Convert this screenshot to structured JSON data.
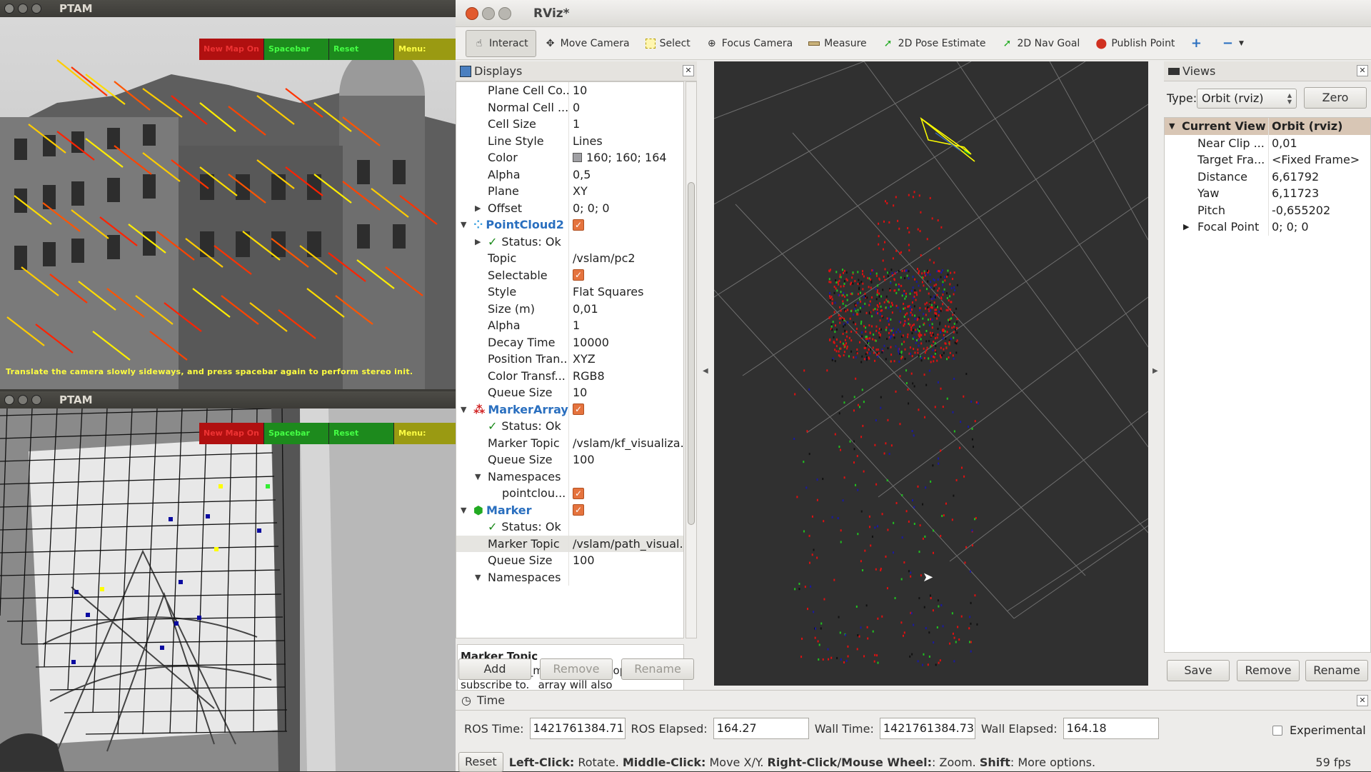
{
  "ptam_top": {
    "title": "PTAM",
    "menu": [
      "New Map On",
      "Spacebar",
      "Reset",
      "Menu:"
    ],
    "caption": "Translate the camera slowly sideways, and press spacebar again to perform stereo init."
  },
  "ptam_bottom": {
    "title": "PTAM",
    "menu": [
      "New Map On",
      "Spacebar",
      "Reset",
      "Menu:"
    ]
  },
  "rviz": {
    "title": "RViz*",
    "toolbar": {
      "interact": "Interact",
      "move_camera": "Move Camera",
      "select": "Select",
      "focus_camera": "Focus Camera",
      "measure": "Measure",
      "pose_estimate": "2D Pose Estimate",
      "nav_goal": "2D Nav Goal",
      "publish_point": "Publish Point"
    },
    "displays": {
      "title": "Displays",
      "rows": [
        {
          "k": "Plane Cell Co...",
          "v": "10"
        },
        {
          "k": "Normal Cell ...",
          "v": "0"
        },
        {
          "k": "Cell Size",
          "v": "1"
        },
        {
          "k": "Line Style",
          "v": "Lines"
        },
        {
          "k": "Color",
          "v": "160; 160; 164"
        },
        {
          "k": "Alpha",
          "v": "0,5"
        },
        {
          "k": "Plane",
          "v": "XY"
        },
        {
          "k": "Offset",
          "v": "0; 0; 0"
        },
        {
          "k": "PointCloud2",
          "v": ""
        },
        {
          "k": "Status: Ok",
          "v": ""
        },
        {
          "k": "Topic",
          "v": "/vslam/pc2"
        },
        {
          "k": "Selectable",
          "v": ""
        },
        {
          "k": "Style",
          "v": "Flat Squares"
        },
        {
          "k": "Size (m)",
          "v": "0,01"
        },
        {
          "k": "Alpha",
          "v": "1"
        },
        {
          "k": "Decay Time",
          "v": "10000"
        },
        {
          "k": "Position Tran...",
          "v": "XYZ"
        },
        {
          "k": "Color Transf...",
          "v": "RGB8"
        },
        {
          "k": "Queue Size",
          "v": "10"
        },
        {
          "k": "MarkerArray",
          "v": ""
        },
        {
          "k": "Status: Ok",
          "v": ""
        },
        {
          "k": "Marker Topic",
          "v": "/vslam/kf_visualiza..."
        },
        {
          "k": "Queue Size",
          "v": "100"
        },
        {
          "k": "Namespaces",
          "v": ""
        },
        {
          "k": "pointclou...",
          "v": ""
        },
        {
          "k": "Marker",
          "v": ""
        },
        {
          "k": "Status: Ok",
          "v": ""
        },
        {
          "k": "Marker Topic",
          "v": "/vslam/path_visual..."
        },
        {
          "k": "Queue Size",
          "v": "100"
        },
        {
          "k": "Namespaces",
          "v": ""
        }
      ],
      "desc_title": "Marker Topic",
      "desc_text": "visualization_msgs::Marker topic to subscribe to. _array will also automatically be subscribed with type visualization_msgs::MarkerArray.",
      "add": "Add",
      "remove": "Remove",
      "rename": "Rename"
    },
    "views": {
      "title": "Views",
      "type_label": "Type:",
      "type_value": "Orbit (rviz)",
      "zero": "Zero",
      "current_view": "Current View",
      "current_view_value": "Orbit (rviz)",
      "rows": [
        {
          "k": "Near Clip ...",
          "v": "0,01"
        },
        {
          "k": "Target Fra...",
          "v": "<Fixed Frame>"
        },
        {
          "k": "Distance",
          "v": "6,61792"
        },
        {
          "k": "Yaw",
          "v": "6,11723"
        },
        {
          "k": "Pitch",
          "v": "-0,655202"
        },
        {
          "k": "Focal Point",
          "v": "0; 0; 0"
        }
      ],
      "save": "Save",
      "remove": "Remove",
      "rename": "Rename"
    },
    "time": {
      "title": "Time",
      "ros_time_label": "ROS Time:",
      "ros_time": "1421761384.71",
      "ros_elapsed_label": "ROS Elapsed:",
      "ros_elapsed": "164.27",
      "wall_time_label": "Wall Time:",
      "wall_time": "1421761384.73",
      "wall_elapsed_label": "Wall Elapsed:",
      "wall_elapsed": "164.18",
      "experimental": "Experimental"
    },
    "status": {
      "reset": "Reset",
      "left_click": "Left-Click:",
      "left_click_text": " Rotate. ",
      "middle_click": "Middle-Click:",
      "middle_click_text": " Move X/Y. ",
      "right_click": "Right-Click/Mouse Wheel:",
      "right_click_text": ": Zoom. ",
      "shift": "Shift",
      "shift_text": ": More options.",
      "fps": "59 fps"
    }
  }
}
